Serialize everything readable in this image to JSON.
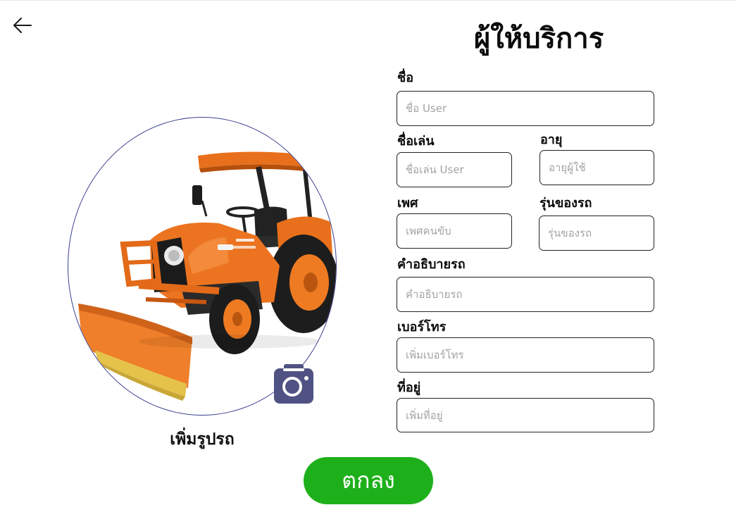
{
  "header": {
    "title": "ผู้ให้บริการ",
    "back_icon": "arrow-left-icon"
  },
  "photo": {
    "add_label": "เพิ่มรูปรถ",
    "camera_icon": "camera-icon",
    "image_subject": "orange tractor with front blade",
    "border_color": "#3b3f8f",
    "camera_color": "#4f5282"
  },
  "form": {
    "name": {
      "label": "ชื่อ",
      "placeholder": "ชื่อ User"
    },
    "nickname": {
      "label": "ชื่อเล่น",
      "placeholder": "ชื่อเล่น User"
    },
    "age": {
      "label": "อายุ",
      "placeholder": "อายุผู้ใช้"
    },
    "gender": {
      "label": "เพศ",
      "placeholder": "เพศคนขับ"
    },
    "model": {
      "label": "รุ่นของรถ",
      "placeholder": "รุ่นของรถ"
    },
    "description": {
      "label": "คำอธิบายรถ",
      "placeholder": "คำอธิบายรถ"
    },
    "phone": {
      "label": "เบอร์โทร",
      "placeholder": "เพิ่มเบอร์โทร"
    },
    "address": {
      "label": "ที่อยู่",
      "placeholder": "เพิ่มที่อยู่"
    }
  },
  "actions": {
    "submit_label": "ตกลง",
    "submit_color": "#1eb01a"
  }
}
